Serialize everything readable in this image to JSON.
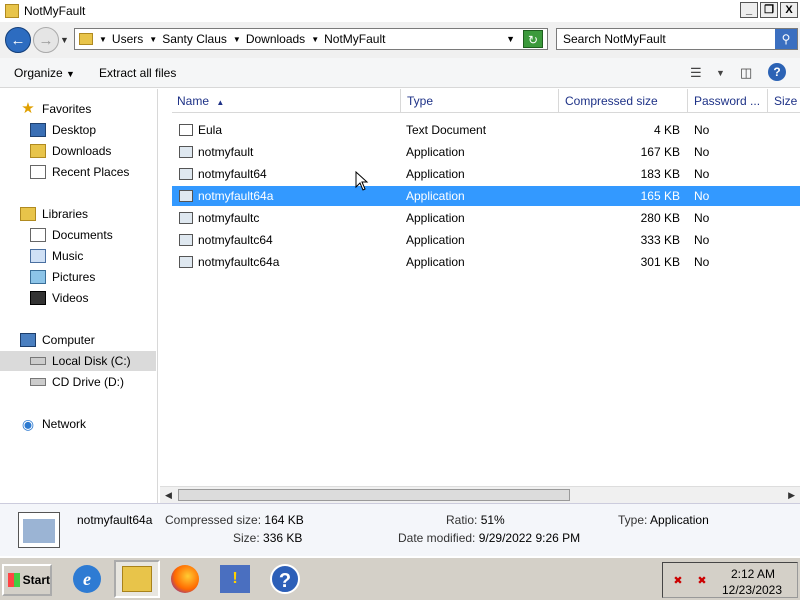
{
  "window": {
    "title": "NotMyFault",
    "controls": {
      "minimize": "_",
      "maximize": "❐",
      "close": "X"
    }
  },
  "address": {
    "crumbs": [
      "Users",
      "Santy Claus",
      "Downloads",
      "NotMyFault"
    ],
    "search_placeholder": "Search NotMyFault"
  },
  "toolbar": {
    "organize": "Organize",
    "extract": "Extract all files"
  },
  "nav": {
    "favorites": "Favorites",
    "desktop": "Desktop",
    "downloads": "Downloads",
    "recent": "Recent Places",
    "libraries": "Libraries",
    "documents": "Documents",
    "music": "Music",
    "pictures": "Pictures",
    "videos": "Videos",
    "computer": "Computer",
    "local_disk": "Local Disk (C:)",
    "cd_drive": "CD Drive (D:)",
    "network": "Network"
  },
  "columns": {
    "name": "Name",
    "type": "Type",
    "compressed": "Compressed size",
    "password": "Password ...",
    "size": "Size"
  },
  "files": [
    {
      "name": "Eula",
      "type": "Text Document",
      "compressed": "4 KB",
      "password": "No"
    },
    {
      "name": "notmyfault",
      "type": "Application",
      "compressed": "167 KB",
      "password": "No"
    },
    {
      "name": "notmyfault64",
      "type": "Application",
      "compressed": "183 KB",
      "password": "No"
    },
    {
      "name": "notmyfault64a",
      "type": "Application",
      "compressed": "165 KB",
      "password": "No"
    },
    {
      "name": "notmyfaultc",
      "type": "Application",
      "compressed": "280 KB",
      "password": "No"
    },
    {
      "name": "notmyfaultc64",
      "type": "Application",
      "compressed": "333 KB",
      "password": "No"
    },
    {
      "name": "notmyfaultc64a",
      "type": "Application",
      "compressed": "301 KB",
      "password": "No"
    }
  ],
  "details": {
    "name": "notmyfault64a",
    "compressed_label": "Compressed size:",
    "compressed_value": "164 KB",
    "size_label": "Size:",
    "size_value": "336 KB",
    "ratio_label": "Ratio:",
    "ratio_value": "51%",
    "modified_label": "Date modified:",
    "modified_value": "9/29/2022 9:26 PM",
    "type_label": "Type:",
    "type_value": "Application"
  },
  "taskbar": {
    "start": "Start",
    "time": "2:12 AM",
    "date": "12/23/2023"
  }
}
